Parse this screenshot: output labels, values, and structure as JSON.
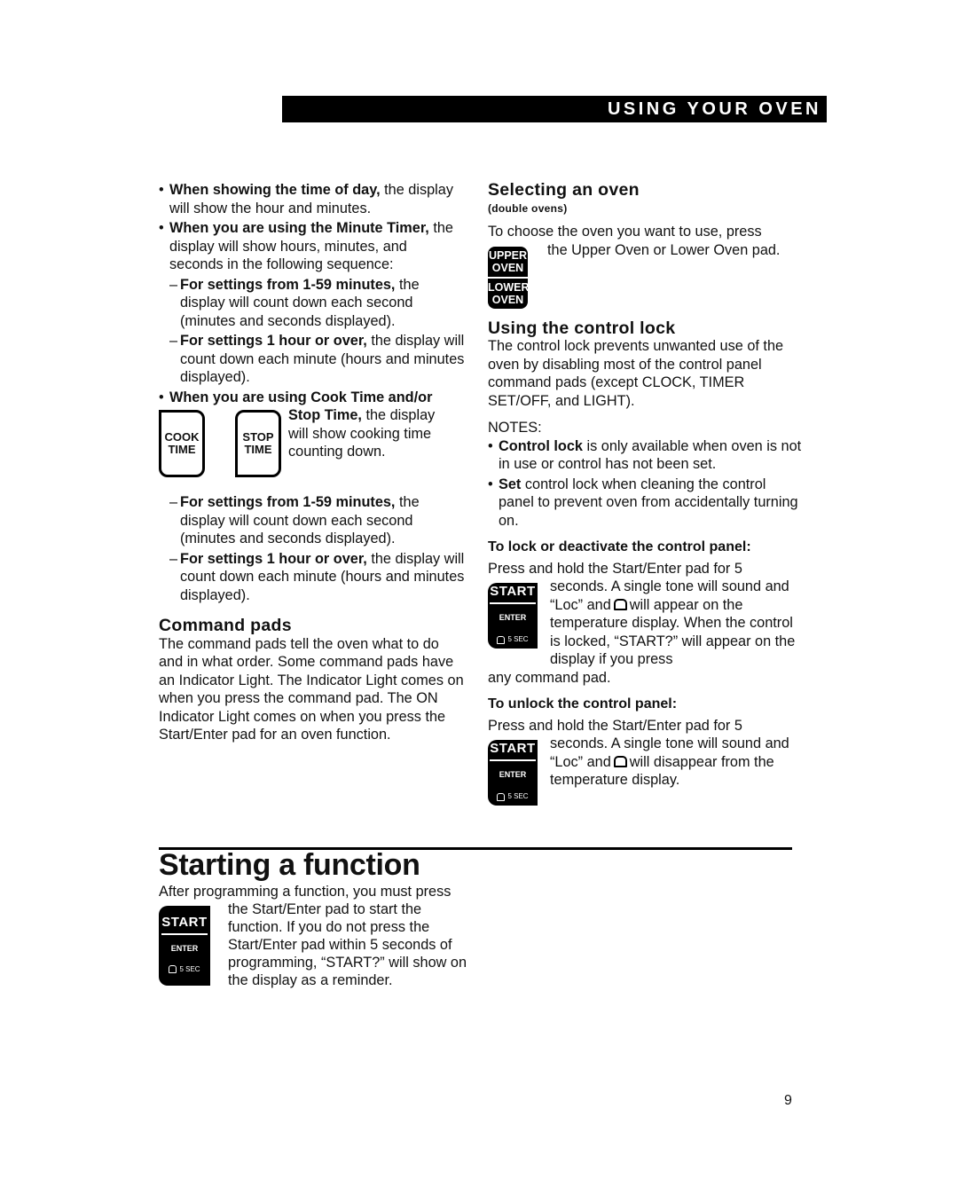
{
  "header": {
    "title": "USING YOUR OVEN"
  },
  "left_column": {
    "bullet_time_of_day": {
      "bold": "When showing the time of day,",
      "rest": " the display will show the hour and minutes."
    },
    "bullet_minute_timer": {
      "bold": "When you are using the Minute Timer,",
      "rest": " the display will show hours, minutes, and seconds in the following sequence:"
    },
    "timer_dash_1": {
      "bold": "For settings from 1-59 minutes,",
      "rest": " the display will count down each second (minutes and seconds displayed)."
    },
    "timer_dash_2": {
      "bold": "For settings 1 hour or over,",
      "rest": " the display will count down each minute (hours and minutes displayed)."
    },
    "bullet_cook_time": {
      "bold_line1": "When you are using Cook Time and/or",
      "bold_line2": "Stop Time,",
      "rest": " the display will show cooking time counting down."
    },
    "pads": {
      "cook_time_line1": "COOK",
      "cook_time_line2": "TIME",
      "stop_time_line1": "STOP",
      "stop_time_line2": "TIME"
    },
    "cook_dash_1": {
      "bold": "For settings from 1-59 minutes,",
      "rest": " the display will count down each second (minutes and seconds displayed)."
    },
    "cook_dash_2": {
      "bold": "For settings 1 hour or over,",
      "rest": " the display will count down each minute (hours and minutes displayed)."
    },
    "command_pads": {
      "heading": "Command pads",
      "body": "The command pads tell the oven what to do and in what order. Some command pads have an Indicator Light. The Indicator Light comes on when you press the command pad. The ON Indicator Light comes on when you press the Start/Enter pad for an oven function."
    }
  },
  "right_column": {
    "selecting_oven": {
      "heading": "Selecting an oven",
      "subheading": "(double ovens)",
      "line1": "To choose the oven you want to use, press",
      "line2": "the Upper Oven or Lower Oven pad.",
      "upper_pad_line1": "UPPER",
      "upper_pad_line2": "OVEN",
      "lower_pad_line1": "LOWER",
      "lower_pad_line2": "OVEN"
    },
    "control_lock": {
      "heading": "Using the control lock",
      "body": "The control lock prevents unwanted use of the oven by disabling most of the control panel command pads (except CLOCK, TIMER SET/OFF, and LIGHT).",
      "notes_label": "NOTES:",
      "note1": {
        "bold": "Control lock",
        "rest": " is only available when oven is not in use or control has not been set."
      },
      "note2": {
        "bold": "Set",
        "rest": " control lock when cleaning the control panel to prevent oven from accidentally turning on."
      }
    },
    "lock_steps": {
      "heading": "To lock or deactivate the control panel:",
      "line1": "Press and hold the Start/Enter pad for 5",
      "text_a": "seconds. A single tone will sound and “Loc” and",
      "text_b": "will appear on the temperature display.  When the control is locked, “START?” will appear on the display if you press",
      "tail": "any command pad."
    },
    "unlock_steps": {
      "heading": "To unlock the control panel:",
      "line1": "Press and hold the Start/Enter pad for 5",
      "text_a": "seconds. A single tone will sound and “Loc” and",
      "text_b": "will disappear from the temperature display."
    }
  },
  "start_pad": {
    "label": "START",
    "sub": "ENTER",
    "hold": "5 SEC"
  },
  "starting_function": {
    "heading": "Starting a function",
    "line1": "After programming a function, you must press",
    "body": "the Start/Enter pad to start the function. If you do not press the Start/Enter pad within 5 seconds of programming, “START?” will show on the display as a reminder."
  },
  "page_number": "9"
}
